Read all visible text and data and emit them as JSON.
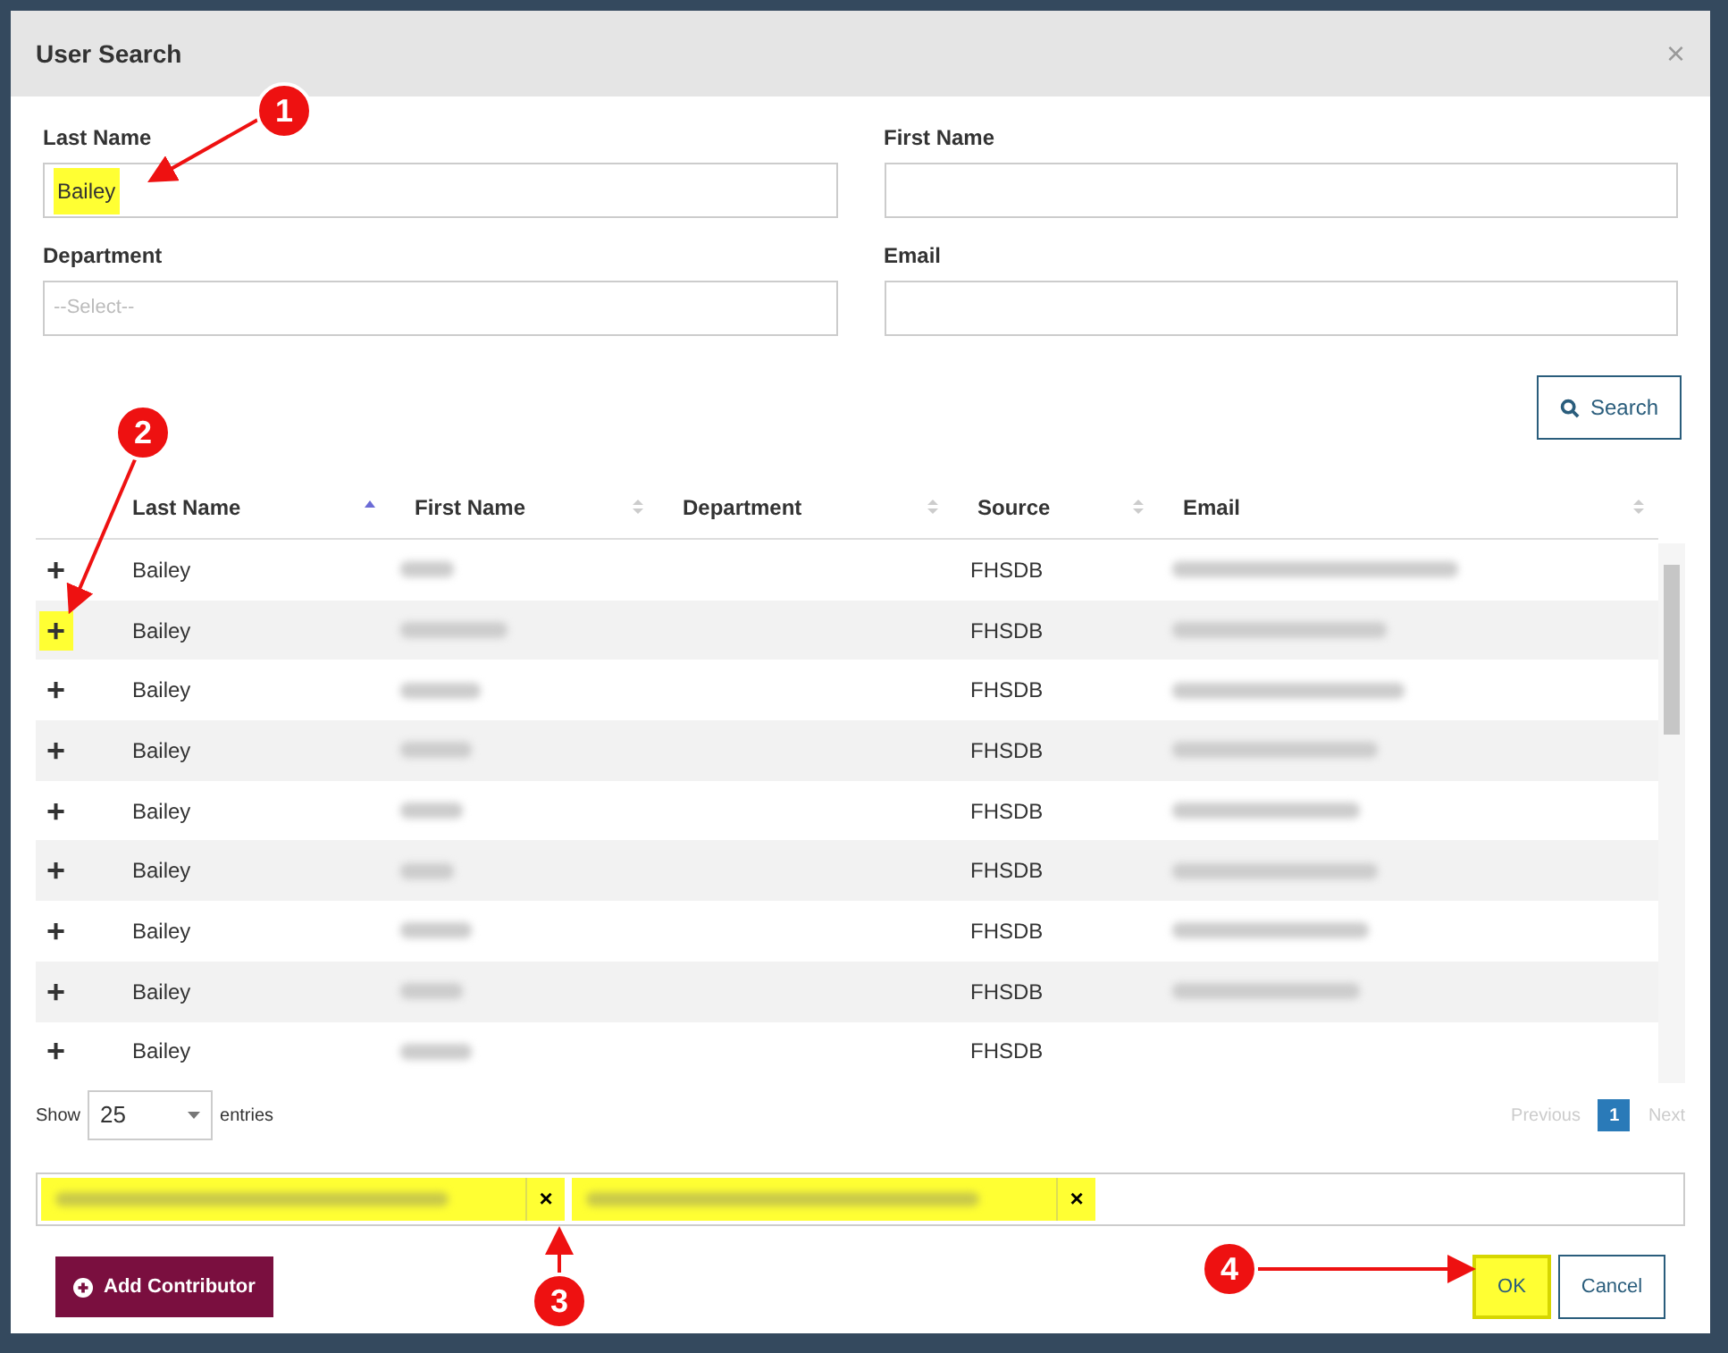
{
  "dialog": {
    "title": "User Search",
    "close": "×"
  },
  "form": {
    "fields": [
      {
        "label": "Last Name",
        "value": "Bailey",
        "highlighted": true
      },
      {
        "label": "First Name"
      },
      {
        "label": "Department",
        "placeholder": "--Select--",
        "kind": "select"
      },
      {
        "label": "Email"
      }
    ],
    "search_button": "Search"
  },
  "table": {
    "columns": [
      {
        "label": "Last Name",
        "sorted": true
      },
      {
        "label": "First Name",
        "sorted": false
      },
      {
        "label": "Department",
        "sorted": false
      },
      {
        "label": "Source",
        "sorted": false
      },
      {
        "label": "Email",
        "sorted": false
      }
    ],
    "rows": [
      {
        "add": "+",
        "last_name": "Bailey",
        "source": "FHSDB",
        "highlighted": false
      },
      {
        "add": "+",
        "last_name": "Bailey",
        "source": "FHSDB",
        "highlighted": true
      },
      {
        "add": "+",
        "last_name": "Bailey",
        "source": "FHSDB",
        "highlighted": false
      },
      {
        "add": "+",
        "last_name": "Bailey",
        "source": "FHSDB",
        "highlighted": false
      },
      {
        "add": "+",
        "last_name": "Bailey",
        "source": "FHSDB",
        "highlighted": false
      },
      {
        "add": "+",
        "last_name": "Bailey",
        "source": "FHSDB",
        "highlighted": false
      },
      {
        "add": "+",
        "last_name": "Bailey",
        "source": "FHSDB",
        "highlighted": false
      },
      {
        "add": "+",
        "last_name": "Bailey",
        "source": "FHSDB",
        "highlighted": false
      },
      {
        "add": "+",
        "last_name": "Bailey",
        "source": "FHSDB",
        "highlighted": false
      }
    ]
  },
  "length": {
    "show": "Show",
    "value": "25",
    "entries": "entries"
  },
  "pagination": {
    "previous": "Previous",
    "pages": [
      {
        "label": "1",
        "selected": true
      }
    ],
    "next": "Next"
  },
  "selected_users": [
    {
      "remove": "×"
    },
    {
      "remove": "×"
    }
  ],
  "buttons": {
    "add_contributor": "Add Contributor",
    "ok": "OK",
    "cancel": "Cancel"
  },
  "callouts": [
    {
      "number": "1"
    },
    {
      "number": "2"
    },
    {
      "number": "3"
    },
    {
      "number": "4"
    }
  ]
}
